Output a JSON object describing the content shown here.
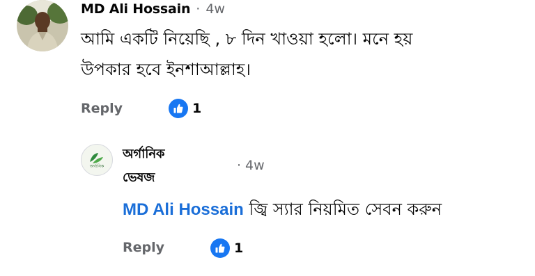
{
  "comment": {
    "author": "MD Ali Hossain",
    "separator": "·",
    "age": "4w",
    "text_line1": "আমি একটি নিয়েছি , ৮ দিন খাওয়া হলো। মনে হয়",
    "text_line2": "উপকার হবে ইনশাআল্লাহ।",
    "reply_label": "Reply",
    "like_count": "1"
  },
  "reply": {
    "author_line1": "অর্গানিক",
    "author_line2": "ভেষজ",
    "separator": "·",
    "age": "4w",
    "mention": "MD Ali Hossain",
    "text": "জ্বি স্যার নিয়মিত সেবন করুন",
    "reply_label": "Reply",
    "like_count": "1",
    "logo_text": "অর্গানিক"
  },
  "colors": {
    "accent": "#1877f2",
    "mention": "#1a6ed8",
    "muted": "#65676b"
  },
  "icons": {
    "like": "thumbs-up-icon"
  }
}
